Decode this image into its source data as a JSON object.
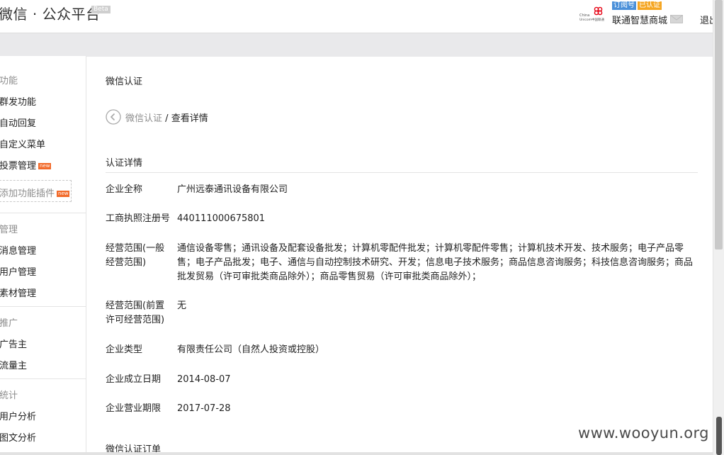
{
  "header": {
    "app_title": "微信 · 公众平台",
    "beta": "Beta",
    "logo_text": "China Unicom中国联通",
    "badge_type": "订阅号",
    "badge_verified": "已认证",
    "account_name": "联通智慧商城",
    "logout": "退出"
  },
  "sidebar": {
    "items": [
      {
        "label": "功能",
        "kind": "head"
      },
      {
        "label": "群发功能"
      },
      {
        "label": "自动回复"
      },
      {
        "label": "自定义菜单"
      },
      {
        "label": "投票管理",
        "new": "new"
      },
      {
        "label": "添加功能插件",
        "new": "new"
      },
      {
        "label": "管理",
        "kind": "head"
      },
      {
        "label": "消息管理"
      },
      {
        "label": "用户管理"
      },
      {
        "label": "素材管理"
      },
      {
        "label": "推广",
        "kind": "head"
      },
      {
        "label": "广告主"
      },
      {
        "label": "流量主"
      },
      {
        "label": "统计",
        "kind": "head"
      },
      {
        "label": "用户分析"
      },
      {
        "label": "图文分析"
      }
    ]
  },
  "main": {
    "heading": "微信认证",
    "breadcrumb": {
      "link": "微信认证",
      "sep": "/",
      "current": "查看详情"
    },
    "section_title": "认证详情",
    "rows": [
      {
        "label": "企业全称",
        "value": "广州远泰通讯设备有限公司"
      },
      {
        "label": "工商执照注册号",
        "value": "440111000675801"
      },
      {
        "label": "经营范围(一般经营范围)",
        "value": "通信设备零售；通讯设备及配套设备批发；计算机零配件批发；计算机零配件零售；计算机技术开发、技术服务；电子产品零售；电子产品批发；电子、通信与自动控制技术研究、开发；信息电子技术服务；商品信息咨询服务；科技信息咨询服务；商品批发贸易（许可审批类商品除外）；商品零售贸易（许可审批类商品除外）；"
      },
      {
        "label": "经营范围(前置许可经营范围)",
        "value": "无"
      },
      {
        "label": "企业类型",
        "value": "有限责任公司（自然人投资或控股）"
      },
      {
        "label": "企业成立日期",
        "value": "2014-08-07"
      },
      {
        "label": "企业营业期限",
        "value": "2017-07-28"
      }
    ],
    "order_title": "微信认证订单"
  },
  "watermark": "www.wooyun.org",
  "colors": {
    "muted": "#8d8d8d",
    "band": "#e9e9eb",
    "new_badge": "#f26a2a",
    "unicom_red": "#e60012"
  }
}
